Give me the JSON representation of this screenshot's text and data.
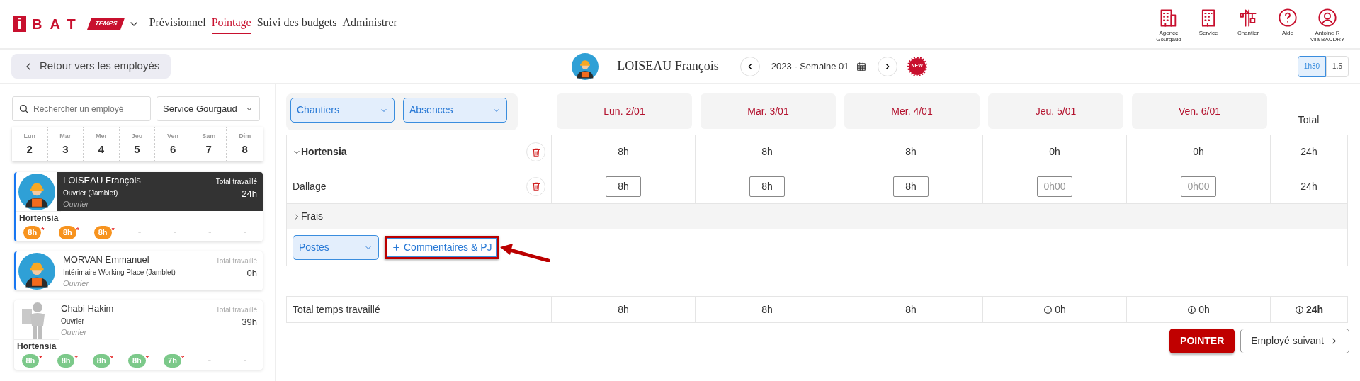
{
  "app": {
    "logo": {
      "letter": "i",
      "name": "BAT",
      "badge": "TEMPS"
    },
    "nav": [
      {
        "label": "Prévisionnel",
        "selected": false
      },
      {
        "label": "Pointage",
        "selected": true
      },
      {
        "label": "Suivi des budgets",
        "selected": false
      },
      {
        "label": "Administrer",
        "selected": false
      }
    ],
    "shortcuts": [
      {
        "kind": "agency",
        "label": "Agence Gourgaud"
      },
      {
        "kind": "building",
        "label": "Service"
      },
      {
        "kind": "crane",
        "label": "Chantier"
      },
      {
        "kind": "help",
        "label": "Aide"
      },
      {
        "kind": "user",
        "label": "Antoine R",
        "sublabel": "Vila BAUDRY"
      }
    ]
  },
  "subbar": {
    "back": "Retour vers les employés",
    "employee": "LOISEAU François",
    "week": "2023 - Semaine 01",
    "new_badge": "NEW",
    "format_toggle": [
      {
        "label": "1h30",
        "selected": true
      },
      {
        "label": "1.5",
        "selected": false
      }
    ]
  },
  "sidebar": {
    "search": {
      "placeholder": "Rechercher un employé"
    },
    "service": "Service Gourgaud",
    "days": [
      {
        "abbr": "Lun",
        "num": "2"
      },
      {
        "abbr": "Mar",
        "num": "3"
      },
      {
        "abbr": "Mer",
        "num": "4"
      },
      {
        "abbr": "Jeu",
        "num": "5"
      },
      {
        "abbr": "Ven",
        "num": "6"
      },
      {
        "abbr": "Sam",
        "num": "7"
      },
      {
        "abbr": "Dim",
        "num": "8"
      }
    ],
    "employees": [
      {
        "name": "LOISEAU François",
        "role": "Ouvrier (Jamblet)",
        "category": "Ouvrier",
        "total_label": "Total travaillé",
        "total": "24h",
        "selected": true,
        "marked": true,
        "avatar": {
          "kind": "worker"
        },
        "site": "Hortensia",
        "hours": [
          {
            "text": "8h",
            "note": "*",
            "color": "#f7931e"
          },
          {
            "text": "8h",
            "note": "*",
            "color": "#f7931e"
          },
          {
            "text": "8h",
            "note": "*",
            "color": "#f7931e"
          },
          {
            "text": "-"
          },
          {
            "text": "-"
          },
          {
            "text": "-"
          },
          {
            "text": "-"
          }
        ]
      },
      {
        "name": "MORVAN Emmanuel",
        "role": "Intérimaire Working Place (Jamblet)",
        "category": "Ouvrier",
        "total_label": "Total travaillé",
        "total": "0h",
        "selected": false,
        "marked": true,
        "avatar": {
          "kind": "worker"
        }
      },
      {
        "name": "Chabi Hakim",
        "role": "Ouvrier",
        "category": "Ouvrier",
        "total_label": "Total travaillé",
        "total": "39h",
        "selected": false,
        "marked": false,
        "avatar": {
          "kind": "silhouette"
        },
        "site": "Hortensia",
        "hours": [
          {
            "text": "8h",
            "note": "*",
            "color": "#7cc98a"
          },
          {
            "text": "8h",
            "note": "*",
            "color": "#7cc98a"
          },
          {
            "text": "8h",
            "note": "*",
            "color": "#7cc98a"
          },
          {
            "text": "8h",
            "note": "*",
            "color": "#7cc98a"
          },
          {
            "text": "7h",
            "note": "*",
            "color": "#7cc98a"
          },
          {
            "text": "-"
          },
          {
            "text": "-"
          }
        ]
      }
    ]
  },
  "timesheet": {
    "filters": [
      {
        "label": "Chantiers"
      },
      {
        "label": "Absences"
      }
    ],
    "days": [
      "Lun. 2/01",
      "Mar. 3/01",
      "Mer. 4/01",
      "Jeu. 5/01",
      "Ven. 6/01"
    ],
    "total_header": "Total",
    "rows": [
      {
        "kind": "group",
        "label": "Hortensia",
        "expanded": true,
        "cells": [
          "8h",
          "8h",
          "8h",
          "0h",
          "0h"
        ],
        "total": "24h"
      },
      {
        "kind": "task",
        "label": "Dallage",
        "inputs": [
          {
            "value": "8h"
          },
          {
            "value": "8h"
          },
          {
            "value": "8h"
          },
          {
            "placeholder": "0h00"
          },
          {
            "placeholder": "0h00"
          }
        ],
        "total": "24h"
      },
      {
        "kind": "section",
        "label": "Frais",
        "expanded": false
      },
      {
        "kind": "actions",
        "dropdown": "Postes",
        "button": "Commentaires & PJ",
        "highlighted": true
      }
    ],
    "totals": {
      "label": "Total temps travaillé",
      "cells": [
        {
          "text": "8h",
          "info": false
        },
        {
          "text": "8h",
          "info": false
        },
        {
          "text": "8h",
          "info": false
        },
        {
          "text": "0h",
          "info": true
        },
        {
          "text": "0h",
          "info": true
        }
      ],
      "total": {
        "text": "24h",
        "info": true
      }
    },
    "buttons": {
      "submit": "POINTER",
      "next": "Employé suivant"
    }
  }
}
